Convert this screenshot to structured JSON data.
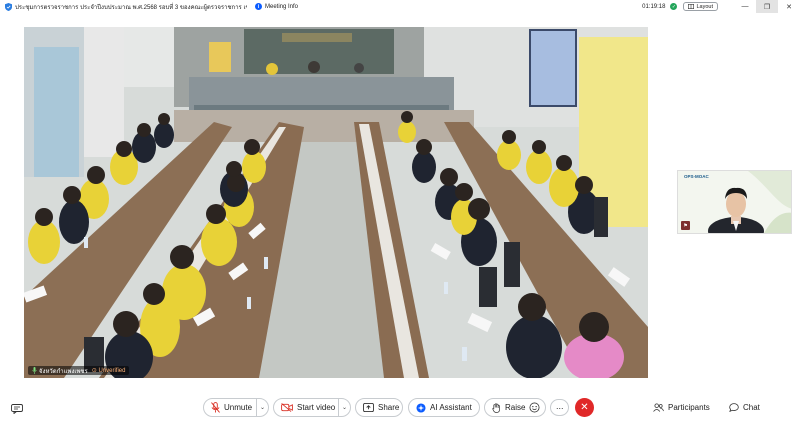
{
  "window": {
    "title": "ประชุมการตรวจราชการ ประจำปีงบประมาณ พ.ศ.2568 รอบที่ 3 ของคณะผู้ตรวจราชการ เขต 18",
    "meeting_info_label": "Meeting Info",
    "meeting_info_icon": "i",
    "timer": "01:19:18",
    "layout_label": "Layout",
    "minimize_glyph": "—",
    "restore_glyph": "❐",
    "close_glyph": "✕"
  },
  "main_video": {
    "participant_name": "จังหวัดกำแพงเพชร",
    "unverified_label": "Unverified",
    "unverified_glyph": "⊙"
  },
  "self_view": {
    "logo_abbr": "OPS-MOAC",
    "corner_glyph": "⚑"
  },
  "toolbar": {
    "unmute_label": "Unmute",
    "start_video_label": "Start video",
    "share_label": "Share",
    "ai_assistant_label": "AI Assistant",
    "raise_label": "Raise",
    "more_glyph": "···",
    "leave_glyph": "✕",
    "participants_label": "Participants",
    "chat_label": "Chat",
    "chevron_glyph": "⌄"
  },
  "colors": {
    "accent": "#0b5cff",
    "leave": "#e02828",
    "mute_red": "#d93025",
    "unverified": "#ffb37a"
  }
}
